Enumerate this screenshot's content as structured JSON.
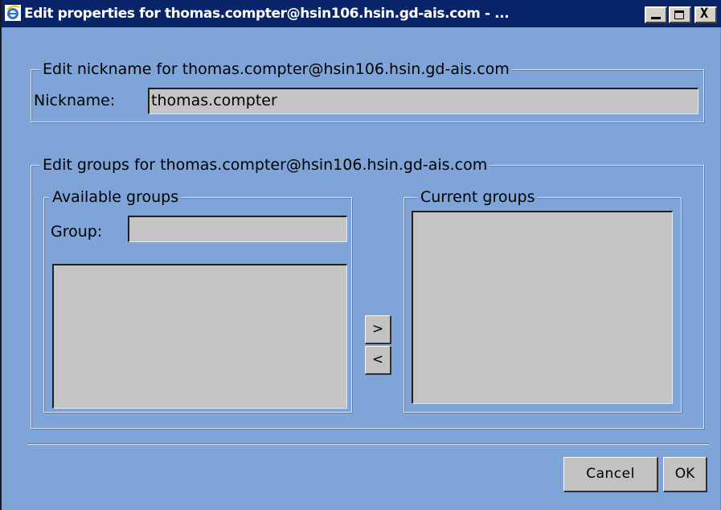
{
  "window": {
    "title": "Edit properties for thomas.compter@hsin106.hsin.gd-ais.com - ...",
    "app_icon": "internet-explorer-icon",
    "controls": {
      "minimize_icon": "minimize-icon",
      "maximize_icon": "maximize-icon",
      "close_icon": "close-icon",
      "close_glyph": "X"
    }
  },
  "nickname_section": {
    "legend": "Edit nickname for thomas.compter@hsin106.hsin.gd-ais.com",
    "label": "Nickname:",
    "value": "thomas.compter"
  },
  "groups_section": {
    "legend": "Edit groups for thomas.compter@hsin106.hsin.gd-ais.com",
    "available": {
      "legend": "Available groups",
      "group_label": "Group:",
      "group_value": "",
      "items": []
    },
    "current": {
      "legend": "Current groups",
      "items": []
    },
    "add_button": ">",
    "remove_button": "<"
  },
  "footer": {
    "cancel_label": "Cancel",
    "ok_label": "OK"
  },
  "colors": {
    "background": "#7ea4d8",
    "titlebar": "#0a246a",
    "field": "#c4c4c4",
    "button": "#c2c2c2"
  }
}
